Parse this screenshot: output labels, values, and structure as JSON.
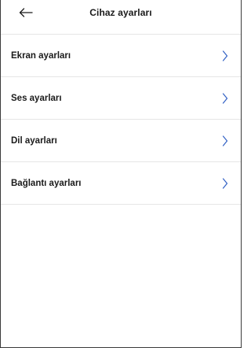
{
  "header": {
    "title": "Cihaz ayarları",
    "back_icon": "arrow-left-icon"
  },
  "settings": {
    "items": [
      {
        "label": "Ekran ayarları",
        "icon": "chevron-right-icon"
      },
      {
        "label": "Ses ayarları",
        "icon": "chevron-right-icon"
      },
      {
        "label": "Dil ayarları",
        "icon": "chevron-right-icon"
      },
      {
        "label": "Bağlantı ayarları",
        "icon": "chevron-right-icon"
      }
    ]
  },
  "colors": {
    "text": "#1a1a1a",
    "divider": "#e6e6e6",
    "chevron": "#2f5fc4"
  }
}
